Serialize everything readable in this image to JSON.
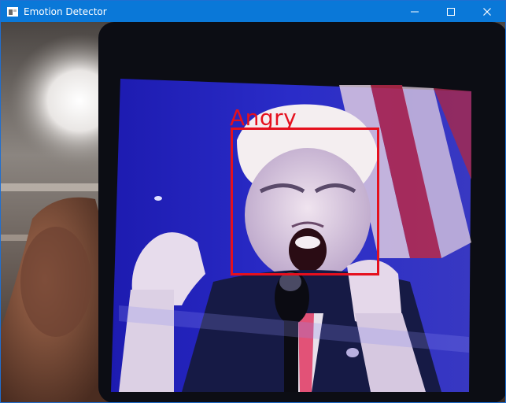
{
  "window": {
    "title": "Emotion Detector",
    "icon": "app-window-icon",
    "controls": [
      "minimize-icon",
      "maximize-icon",
      "close-icon"
    ],
    "accent": "#0a78d8"
  },
  "detection": {
    "label": "Angry",
    "box_color": "#e5101e"
  }
}
